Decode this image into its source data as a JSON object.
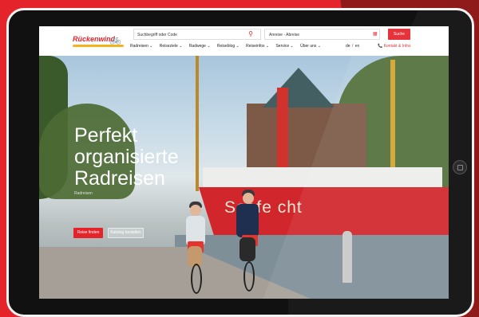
{
  "header": {
    "logo_text": "Rückenwind",
    "search_placeholder": "Suchbegriff oder Code",
    "date_placeholder": "Anreise - Abreise",
    "search_button": "Suche",
    "nav_items": [
      "Radreisen ⌄",
      "Reiseziele ⌄",
      "Radwege ⌄",
      "Reiseblog ⌄",
      "Reiseinfos ⌄",
      "Service ⌄",
      "Über uns ⌄"
    ],
    "lang_de": "de",
    "lang_sep": "/",
    "lang_en": "en",
    "contact": "📞 Kontakt & Infos"
  },
  "hero": {
    "title": "Perfekt organisierte Radreisen",
    "subtitle": "Radreisen",
    "cta_primary": "Reise finden",
    "cta_secondary": "Katalog bestellen",
    "ship_name": "Seefe cht"
  },
  "colors": {
    "brand_red": "#e4232b",
    "brand_yellow": "#f3b41b"
  }
}
